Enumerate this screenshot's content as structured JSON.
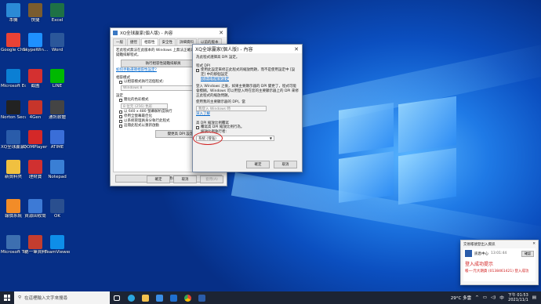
{
  "desktop": {
    "icons": [
      {
        "label": "本機",
        "color": "#2b8ad6"
      },
      {
        "label": "快捷",
        "color": "#7a5c2e"
      },
      {
        "label": "Excel",
        "color": "#1e7145"
      },
      {
        "label": "Google Chrome",
        "color": "#e94235"
      },
      {
        "label": "SkypeWin...",
        "color": "#1e90ff"
      },
      {
        "label": "Word",
        "color": "#2b579a"
      },
      {
        "label": "Microsoft Edge",
        "color": "#0b7fd4"
      },
      {
        "label": "截圖",
        "color": "#d43030"
      },
      {
        "label": "LINE",
        "color": "#00b900"
      },
      {
        "label": "Norton Security",
        "color": "#222222"
      },
      {
        "label": "4Gen",
        "color": "#c7352b"
      },
      {
        "label": "通訊軟體",
        "color": "#444444"
      },
      {
        "label": "XQ全球贏家(個人版)",
        "color": "#2a5caa"
      },
      {
        "label": "DOMPlayer",
        "color": "#d42828"
      },
      {
        "label": "ATIME",
        "color": "#3a6ed8"
      },
      {
        "label": "新資料夾",
        "color": "#f0c040"
      },
      {
        "label": "理財寶",
        "color": "#d03030"
      },
      {
        "label": "Notepad",
        "color": "#3a7fd5"
      },
      {
        "label": "報價系統",
        "color": "#f28c28"
      },
      {
        "label": "資源回收筒",
        "color": "#3d7ad6"
      },
      {
        "label": "OK",
        "color": "#2a4f8f"
      },
      {
        "label": "Microsoft Teams",
        "color": "#3d6fb0"
      },
      {
        "label": "第一筆資料",
        "color": "#c43d2f"
      },
      {
        "label": "TeamViewer",
        "color": "#0e8ee9"
      }
    ]
  },
  "window_back": {
    "title": "XQ全球贏家(個人版) - 內容",
    "tabs": [
      "一般",
      "捷徑",
      "相容性",
      "安全性",
      "詳細資料",
      "以前的版本"
    ],
    "active_tab": 2,
    "intro_text": "若此程式無法在此版本的 Windows 上無法正確運作，請嘗試執行疑難排解程式。",
    "troubleshoot_button": "執行相容性疑難排解員",
    "manual_link": "如何手動選擇相容性設定?",
    "compat_mode_group": "相容模式",
    "compat_mode_check": "以相容模式執行這個程式:",
    "compat_mode_select": "Windows 8",
    "settings_group": "設定",
    "settings_checks": [
      "簡化的色彩模式",
      "8 位元 (256) 色彩",
      "以 640 x 480 螢幕解析度執行",
      "停用全螢幕最佳化",
      "以系統管理員身分執行此程式",
      "註冊此程式以重新啟動"
    ],
    "dpi_button": "變更高 DPI 設定",
    "all_users_button": "變更所有使用者的設定",
    "ok": "確定",
    "cancel": "取消",
    "apply": "套用(A)"
  },
  "window_front": {
    "title": "XQ全球贏家(個人版) - 內容",
    "subtitle": "為此程式選擇高 DPI 設定。",
    "group1": "程式 DPI",
    "check1": "使用此設定來修正此程式的縮放問題，而不是使用設定中 [設定] 中的那個設定",
    "link1": "開啟進階縮放設定",
    "desc": "登入 Windows 之後，如果主要顯示器的 DPI 變更了，程式可能會模糊。Windows 可以用登入時在您的主要顯示器上的 DPI 來修正此程式的縮放問題。",
    "label_dpi": "使用我的主要顯示器的 DPI，當",
    "select_dpi": "我登入 Windows 時",
    "link2": "深入了解",
    "group2": "高 DPI 縮放比例覆寫",
    "check2": "覆寫高 DPI 縮放比例行為。",
    "check2_sub": "縮放比例執行者:",
    "select2": "系統 (增強)",
    "ok": "確定",
    "cancel": "取消"
  },
  "taskbar": {
    "search_placeholder": "在這裡輸入文字來搜尋",
    "weather": "29°C 多雲",
    "ime": "中",
    "time": "下午 01:53",
    "date": "2021/11/1"
  },
  "notification": {
    "header": "交易帳號登出入資訊",
    "close": "✕",
    "app": "訊息中心",
    "time": "13:01:44",
    "ok_label": "確認",
    "line1": "登入成功提示",
    "line2": "帳一·元大期貨 (0138461421) 登入成功"
  },
  "colors": {
    "accent": "#0078d7",
    "highlight_circle": "#d02020",
    "notify_red": "#d01818"
  }
}
